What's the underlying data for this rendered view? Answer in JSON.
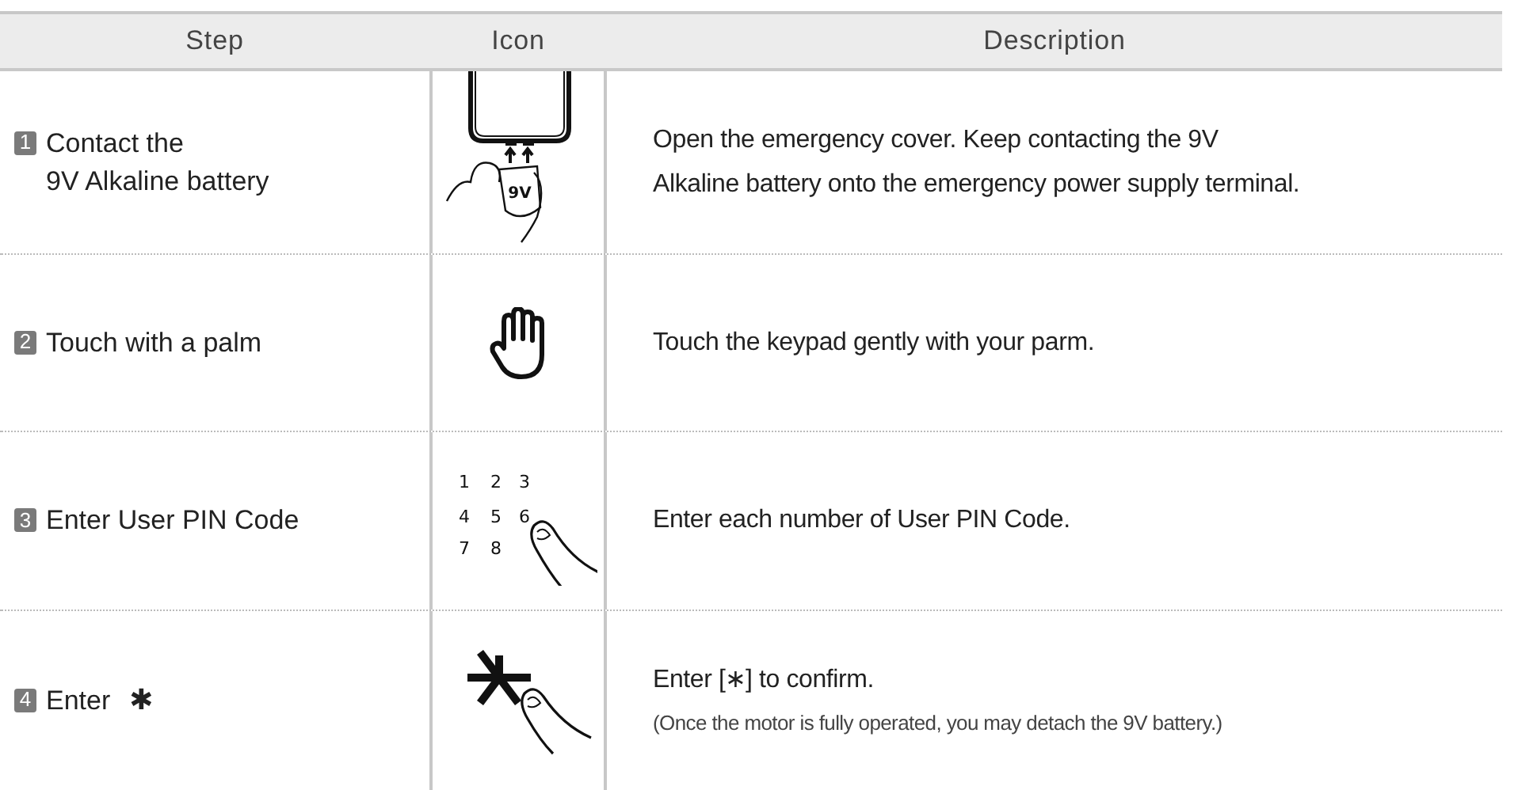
{
  "table": {
    "columns": [
      "Step",
      "Icon",
      "Description"
    ],
    "rows": [
      {
        "number": "1",
        "kind": "battery",
        "step_lines": [
          "Contact the",
          "9V Alkaline battery"
        ],
        "icon_text": [
          "9V"
        ],
        "description_lines": [
          "Open the emergency cover. Keep contacting the 9V",
          "Alkaline battery onto the emergency power supply terminal."
        ]
      },
      {
        "number": "2",
        "kind": "palm",
        "step_lines": [
          "Touch with a palm"
        ],
        "description_lines": [
          "Touch the keypad gently with your parm."
        ]
      },
      {
        "number": "3",
        "kind": "keypad",
        "step_lines": [
          "Enter User PIN Code"
        ],
        "icon_text": [
          "1",
          "2",
          "3",
          "4",
          "5",
          "6",
          "7",
          "8"
        ],
        "description_lines": [
          "Enter each number of User PIN Code."
        ]
      },
      {
        "number": "4",
        "kind": "star",
        "step_lines": [
          "Enter"
        ],
        "step_symbol": "✱",
        "description_lines": [
          "Enter [∗] to confirm."
        ],
        "note": "(Once the motor is fully operated, you may detach the 9V battery.)"
      }
    ]
  }
}
